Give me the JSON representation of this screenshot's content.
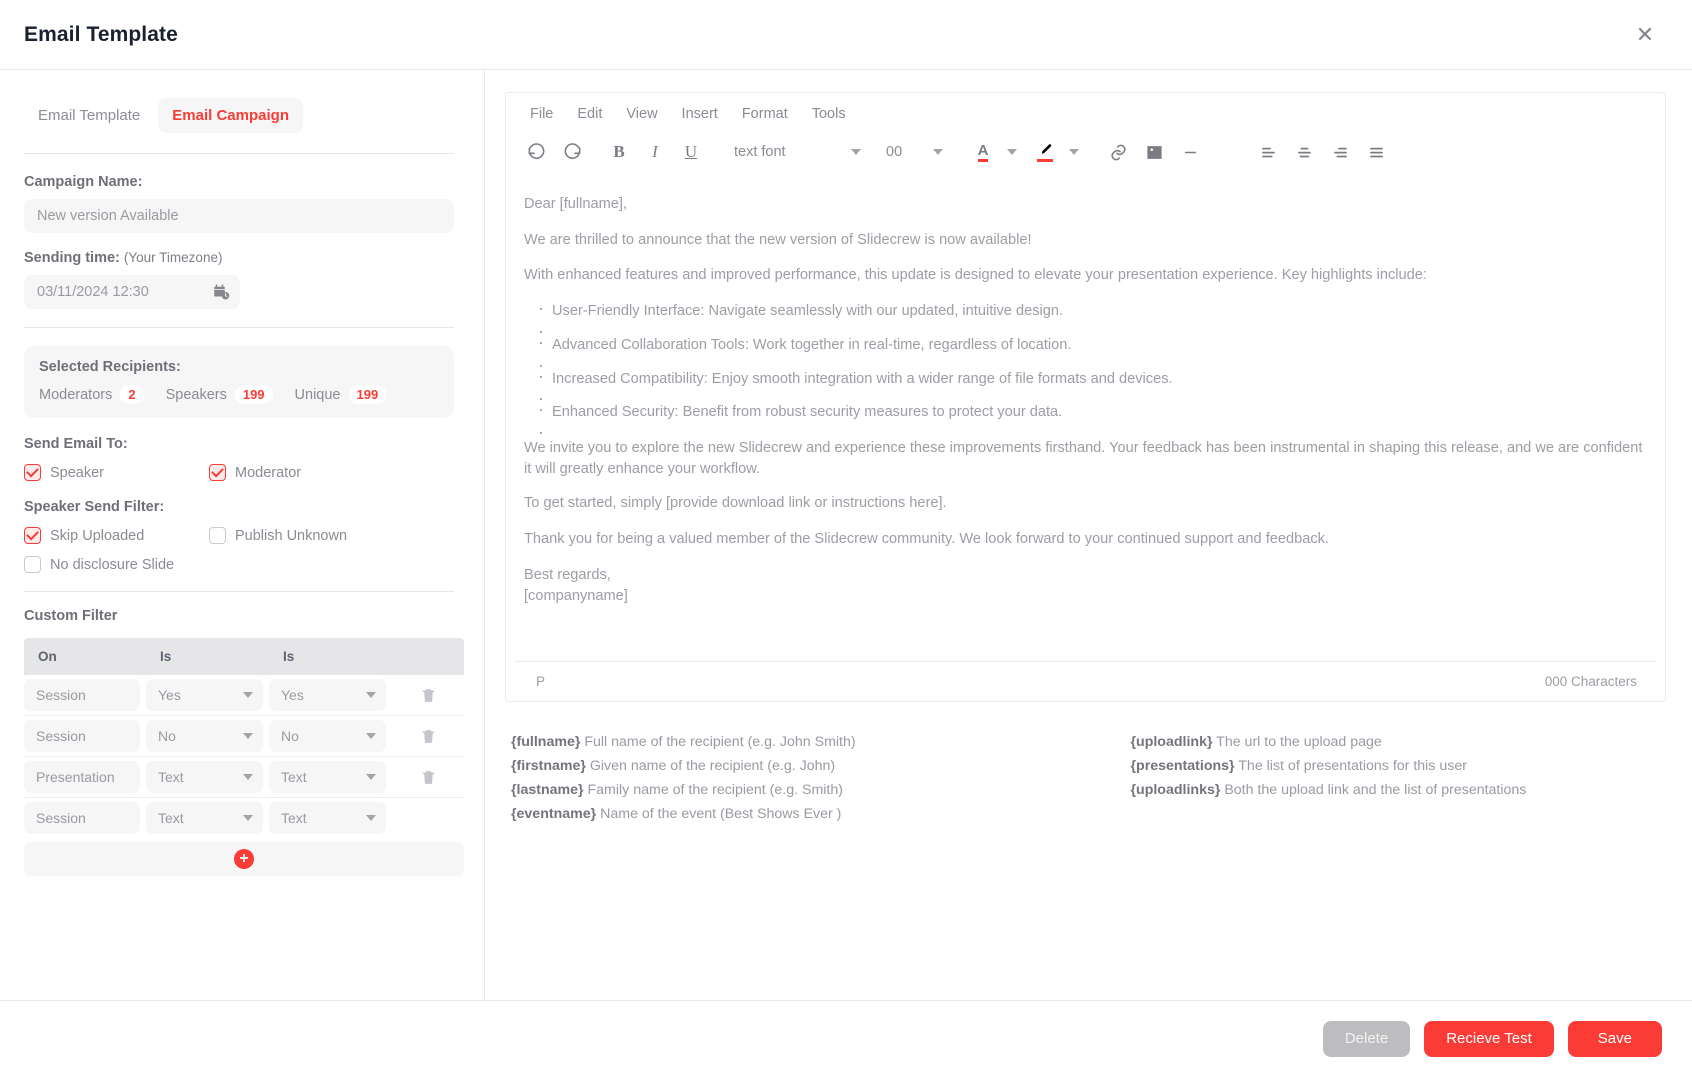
{
  "header": {
    "title": "Email Template",
    "close_icon": "close-icon"
  },
  "tabs": [
    {
      "label": "Email Template",
      "active": false
    },
    {
      "label": "Email Campaign",
      "active": true
    }
  ],
  "form": {
    "campaign_name_label": "Campaign Name:",
    "campaign_name_value": "New version Available",
    "sending_time_label": "Sending time:",
    "sending_time_sub": "(Your Timezone)",
    "sending_time_value": "03/11/2024 12:30",
    "calendar_icon": "calendar-clock-icon"
  },
  "recipients": {
    "title": "Selected Recipients:",
    "items": [
      {
        "name": "Moderators",
        "count": "2"
      },
      {
        "name": "Speakers",
        "count": "199"
      },
      {
        "name": "Unique",
        "count": "199"
      }
    ]
  },
  "send_email_to": {
    "label": "Send Email To:",
    "options": [
      {
        "label": "Speaker",
        "checked": true
      },
      {
        "label": "Moderator",
        "checked": true
      }
    ]
  },
  "speaker_send_filter": {
    "label": "Speaker Send Filter:",
    "options": [
      {
        "label": "Skip Uploaded",
        "checked": true
      },
      {
        "label": "Publish Unknown",
        "checked": false
      },
      {
        "label": "No disclosure Slide",
        "checked": false
      }
    ]
  },
  "custom_filter": {
    "title": "Custom Filter",
    "columns": [
      "On",
      "Is",
      "Is",
      ""
    ],
    "rows": [
      {
        "on": "Session",
        "is1": "Yes",
        "is2": "Yes",
        "deletable": true
      },
      {
        "on": "Session",
        "is1": "No",
        "is2": "No",
        "deletable": true
      },
      {
        "on": "Presentation",
        "is1": "Text",
        "is2": "Text",
        "deletable": true
      },
      {
        "on": "Session",
        "is1": "Text",
        "is2": "Text",
        "deletable": false
      }
    ],
    "add_row_icon": "plus-circle-icon"
  },
  "editor": {
    "menus": [
      "File",
      "Edit",
      "View",
      "Insert",
      "Format",
      "Tools"
    ],
    "toolbar": {
      "undo_icon": "undo-icon",
      "redo_icon": "redo-icon",
      "bold_label": "B",
      "italic_label": "I",
      "underline_label": "U",
      "font_family_value": "text font",
      "font_size_value": "00",
      "text_color_icon": "text-color-icon",
      "highlight_icon": "highlight-pen-icon",
      "link_icon": "link-icon",
      "image_icon": "image-icon",
      "hr_icon": "horizontal-rule-icon",
      "align_left_icon": "align-left-icon",
      "align_center_icon": "align-center-icon",
      "align_right_icon": "align-right-icon",
      "align_justify_icon": "align-justify-icon"
    },
    "content": {
      "greeting": "Dear [fullname],",
      "para1": "We are thrilled to announce that the new version of Slidecrew is now available!",
      "para2": "With enhanced features and improved performance, this update is designed to elevate your presentation experience. Key highlights include:",
      "bullets": [
        "User-Friendly Interface: Navigate seamlessly with our updated, intuitive design.",
        "",
        "Advanced Collaboration Tools: Work together in real-time, regardless of location.",
        "",
        "Increased Compatibility: Enjoy smooth integration with a wider range of file formats and devices.",
        "",
        "Enhanced Security: Benefit from robust security measures to protect your data.",
        ""
      ],
      "para3": "We invite you to explore the new Slidecrew and experience these improvements firsthand. Your feedback has been instrumental in shaping this release, and we are confident it will greatly enhance your workflow.",
      "para4": "To get started, simply [provide download link or instructions here].",
      "para5": "Thank you for being a valued member of the Slidecrew community. We look forward to your continued support and feedback.",
      "signoff": "Best regards,",
      "company": "[companyname]"
    },
    "status": {
      "path": "P",
      "characters": "000 Characters"
    }
  },
  "legend": {
    "left": [
      {
        "token": "{fullname}",
        "desc": " Full name of the recipient (e.g. John Smith)"
      },
      {
        "token": "{firstname}",
        "desc": " Given name of the recipient (e.g. John)"
      },
      {
        "token": "{lastname}",
        "desc": " Family name of the recipient (e.g. Smith)"
      },
      {
        "token": "{eventname}",
        "desc": " Name of the event (Best Shows Ever )"
      }
    ],
    "right": [
      {
        "token": "{uploadlink}",
        "desc": " The url to the upload page"
      },
      {
        "token": "{presentations}",
        "desc": " The list of presentations for this user"
      },
      {
        "token": "{uploadlinks}",
        "desc": " Both the upload link and the list of presentations"
      }
    ]
  },
  "footer": {
    "delete_label": "Delete",
    "recieve_test_label": "Recieve Test",
    "save_label": "Save"
  },
  "colors": {
    "accent": "#fb3b36",
    "muted": "#9a9aa2",
    "title": "#1b2030"
  }
}
